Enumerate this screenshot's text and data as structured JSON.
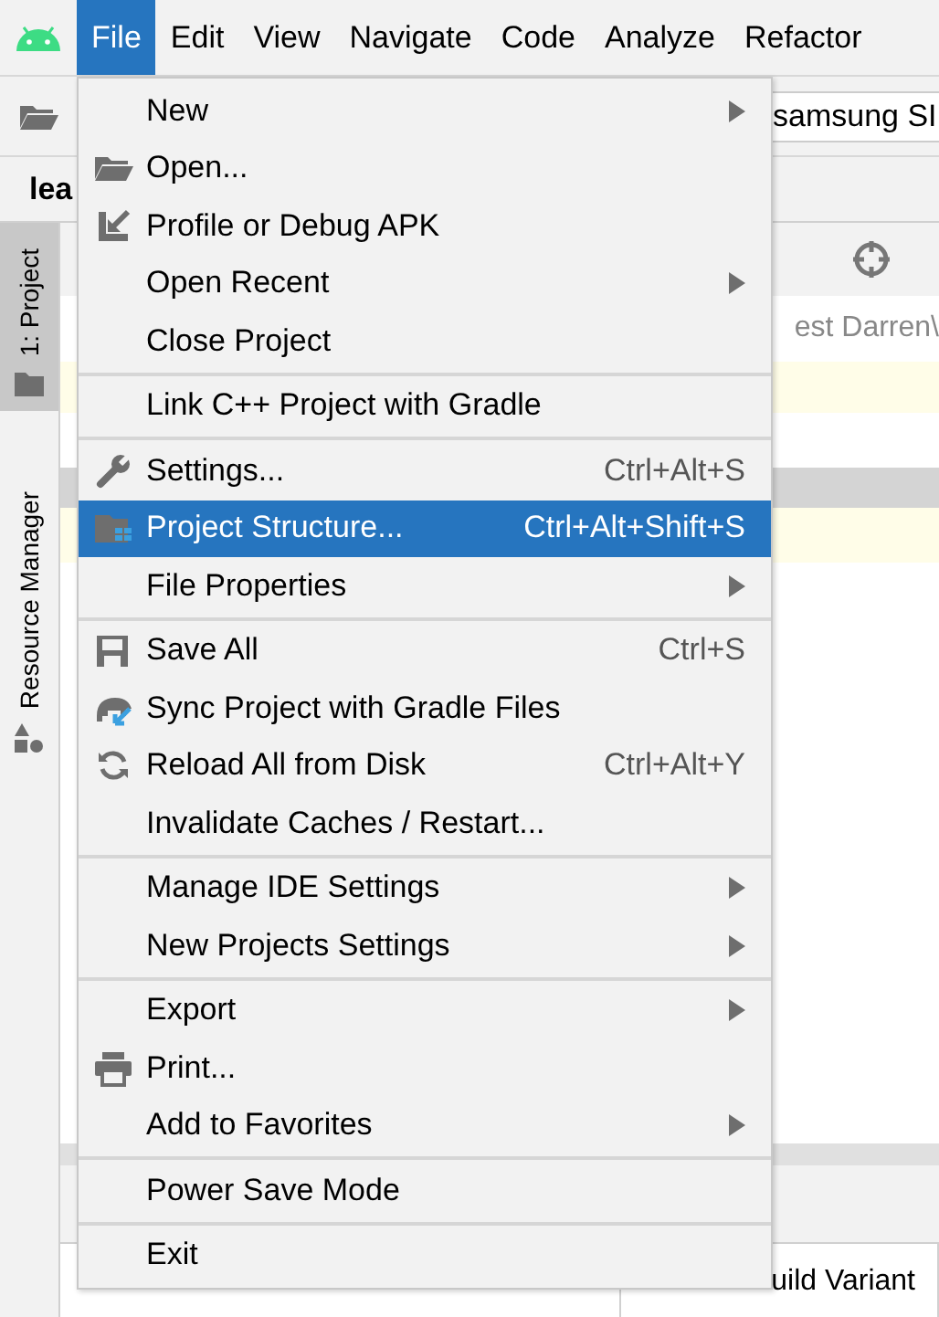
{
  "menu_bar": [
    {
      "label": "File",
      "selected": true
    },
    {
      "label": "Edit",
      "selected": false
    },
    {
      "label": "View",
      "selected": false
    },
    {
      "label": "Navigate",
      "selected": false
    },
    {
      "label": "Code",
      "selected": false
    },
    {
      "label": "Analyze",
      "selected": false
    },
    {
      "label": "Refactor",
      "selected": false
    }
  ],
  "toolbar": {
    "device_field": "samsung SI"
  },
  "editor_tab": {
    "label": "lea"
  },
  "side_tabs": [
    {
      "label": "1: Project",
      "selected": true
    },
    {
      "label": "Resource Manager",
      "selected": false
    }
  ],
  "background": {
    "path_text": "est Darren\\",
    "column_2_visible_part": "uild Variant"
  },
  "file_menu": [
    [
      {
        "label": "New",
        "submenu": true,
        "selected": false
      },
      {
        "label": "Open...",
        "submenu": false,
        "selected": false
      },
      {
        "label": "Profile or Debug APK",
        "submenu": false,
        "selected": false
      },
      {
        "label": "Open Recent",
        "submenu": true,
        "selected": false
      },
      {
        "label": "Close Project",
        "submenu": false,
        "selected": false
      }
    ],
    [
      {
        "label": "Link C++ Project with Gradle",
        "submenu": false,
        "selected": false
      }
    ],
    [
      {
        "label": "Settings...",
        "shortcut": "Ctrl+Alt+S",
        "submenu": false,
        "selected": false
      },
      {
        "label": "Project Structure...",
        "shortcut": "Ctrl+Alt+Shift+S",
        "submenu": false,
        "selected": true
      },
      {
        "label": "File Properties",
        "submenu": true,
        "selected": false
      }
    ],
    [
      {
        "label": "Save All",
        "shortcut": "Ctrl+S",
        "submenu": false,
        "selected": false
      },
      {
        "label": "Sync Project with Gradle Files",
        "submenu": false,
        "selected": false
      },
      {
        "label": "Reload All from Disk",
        "shortcut": "Ctrl+Alt+Y",
        "submenu": false,
        "selected": false
      },
      {
        "label": "Invalidate Caches / Restart...",
        "submenu": false,
        "selected": false
      }
    ],
    [
      {
        "label": "Manage IDE Settings",
        "submenu": true,
        "selected": false
      },
      {
        "label": "New Projects Settings",
        "submenu": true,
        "selected": false
      }
    ],
    [
      {
        "label": "Export",
        "submenu": true,
        "selected": false
      },
      {
        "label": "Print...",
        "submenu": false,
        "selected": false
      },
      {
        "label": "Add to Favorites",
        "submenu": true,
        "selected": false
      }
    ],
    [
      {
        "label": "Power Save Mode",
        "submenu": false,
        "selected": false
      }
    ],
    [
      {
        "label": "Exit",
        "submenu": false,
        "selected": false
      }
    ]
  ]
}
